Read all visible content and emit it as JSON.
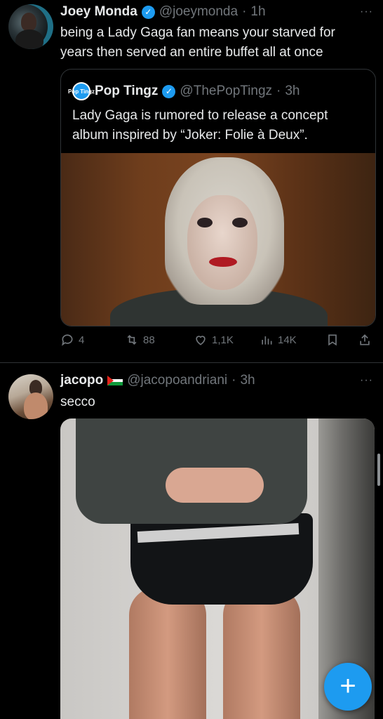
{
  "colors": {
    "background": "#000000",
    "text": "#e7e9ea",
    "secondary": "#71767b",
    "accent": "#1d9bf0",
    "divider": "#2f3336"
  },
  "tweets": [
    {
      "author": {
        "name": "Joey Monda",
        "handle": "@joeymonda",
        "verified": true
      },
      "separator": "·",
      "time": "1h",
      "more": "···",
      "text": "being a Lady Gaga fan means your starved for years then served an entire buffet all at once",
      "quote": {
        "author": {
          "name": "Pop Tingz",
          "handle": "@ThePopTingz",
          "verified": true,
          "avatar_text": "Pop Tingz"
        },
        "separator": "·",
        "time": "3h",
        "text": "Lady Gaga is rumored to release a concept album inspired by “Joker: Folie à Deux”.",
        "image": "photo-lady-gaga-joker-makeup"
      },
      "actions": {
        "replies": "4",
        "reposts": "88",
        "likes": "1,1K",
        "views": "14K"
      }
    },
    {
      "author": {
        "name": "jacopo",
        "handle": "@jacopoandriani",
        "verified": false,
        "flag": "palestine-flag"
      },
      "separator": "·",
      "time": "3h",
      "more": "···",
      "text": "secco",
      "image": "photo-mirror-selfie"
    }
  ],
  "fab": {
    "label": "+",
    "icon": "compose-plus-icon"
  }
}
